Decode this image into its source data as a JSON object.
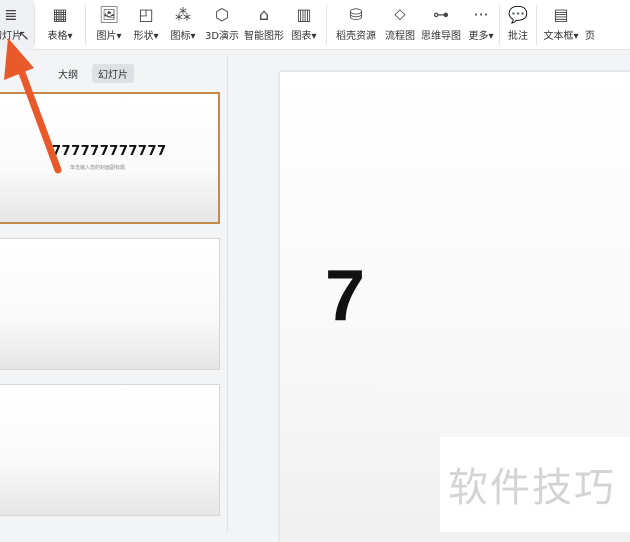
{
  "toolbar": {
    "items": [
      {
        "label": "幻灯片",
        "icon": "new-slide-icon"
      },
      {
        "label": "表格▾",
        "icon": "table-icon"
      },
      {
        "label": "图片▾",
        "icon": "picture-icon"
      },
      {
        "label": "形状▾",
        "icon": "shape-icon"
      },
      {
        "label": "图标▾",
        "icon": "icons-icon"
      },
      {
        "label": "3D演示",
        "icon": "cube-icon"
      },
      {
        "label": "智能图形",
        "icon": "smart-art-icon"
      },
      {
        "label": "图表▾",
        "icon": "chart-icon"
      },
      {
        "label": "稻壳资源",
        "icon": "docer-icon"
      },
      {
        "label": "流程图",
        "icon": "flowchart-icon"
      },
      {
        "label": "思维导图",
        "icon": "mindmap-icon"
      },
      {
        "label": "更多▾",
        "icon": "more-icon"
      },
      {
        "label": "批注",
        "icon": "comment-icon"
      },
      {
        "label": "文本框▾",
        "icon": "textbox-icon"
      },
      {
        "label": "页",
        "icon": ""
      }
    ]
  },
  "panel": {
    "tabs": [
      "大纲",
      "幻灯片"
    ],
    "slide1_title": "777777777777",
    "slide1_subtitle": "单击输入您的封面副标题"
  },
  "canvas": {
    "title_partial": "7"
  },
  "watermark": "软件技巧",
  "colors": {
    "accent": "#c58a4a",
    "arrow": "#e85a2a"
  }
}
